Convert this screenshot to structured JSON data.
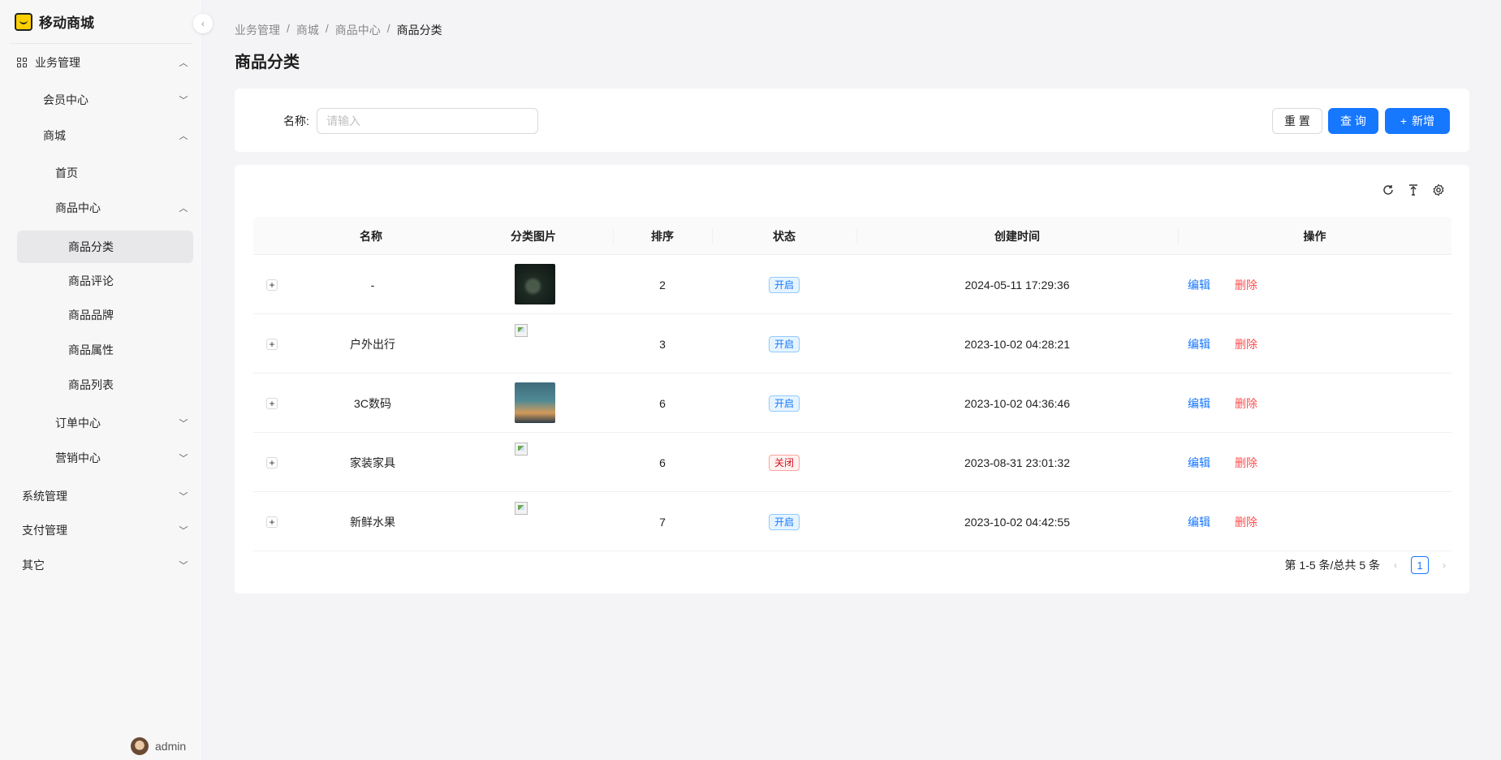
{
  "app": {
    "title": "移动商城"
  },
  "sidebar": {
    "items": [
      {
        "label": "业务管理",
        "arrow": "up"
      },
      {
        "label": "会员中心",
        "arrow": "down"
      },
      {
        "label": "商城",
        "arrow": "up"
      },
      {
        "label": "首页"
      },
      {
        "label": "商品中心",
        "arrow": "up"
      },
      {
        "label": "商品分类",
        "active": true
      },
      {
        "label": "商品评论"
      },
      {
        "label": "商品品牌"
      },
      {
        "label": "商品属性"
      },
      {
        "label": "商品列表"
      },
      {
        "label": "订单中心",
        "arrow": "down"
      },
      {
        "label": "营销中心",
        "arrow": "down"
      },
      {
        "label": "系统管理",
        "arrow": "down"
      },
      {
        "label": "支付管理",
        "arrow": "down"
      },
      {
        "label": "其它",
        "arrow": "down"
      }
    ],
    "user": "admin"
  },
  "breadcrumb": [
    "业务管理",
    "商城",
    "商品中心",
    "商品分类"
  ],
  "breadcrumb_sep": "/",
  "page_title": "商品分类",
  "search": {
    "label": "名称:",
    "placeholder": "请输入",
    "value": "",
    "reset": "重 置",
    "query": "查 询",
    "add": "新增",
    "add_icon": "+"
  },
  "toolbar": {
    "icons": [
      "reload-icon",
      "column-height-icon",
      "setting-icon"
    ]
  },
  "table": {
    "columns": [
      "名称",
      "分类图片",
      "排序",
      "状态",
      "创建时间",
      "操作"
    ],
    "rows": [
      {
        "name": "-",
        "image": "dark-mouse-image",
        "sort": "2",
        "status": "开启",
        "status_on": true,
        "created": "2024-05-11 17:29:36",
        "edit": "编辑",
        "delete": "删除"
      },
      {
        "name": "户外出行",
        "image": "broken",
        "sort": "3",
        "status": "开启",
        "status_on": true,
        "created": "2023-10-02 04:28:21",
        "edit": "编辑",
        "delete": "删除"
      },
      {
        "name": "3C数码",
        "image": "city-night-image",
        "sort": "6",
        "status": "开启",
        "status_on": true,
        "created": "2023-10-02 04:36:46",
        "edit": "编辑",
        "delete": "删除"
      },
      {
        "name": "家装家具",
        "image": "broken",
        "sort": "6",
        "status": "关闭",
        "status_on": false,
        "created": "2023-08-31 23:01:32",
        "edit": "编辑",
        "delete": "删除"
      },
      {
        "name": "新鲜水果",
        "image": "broken",
        "sort": "7",
        "status": "开启",
        "status_on": true,
        "created": "2023-10-02 04:42:55",
        "edit": "编辑",
        "delete": "删除"
      }
    ]
  },
  "pagination": {
    "summary": "第 1-5 条/总共 5 条",
    "current": "1"
  },
  "colors": {
    "primary": "#1677ff",
    "danger": "#ff4d4f"
  }
}
